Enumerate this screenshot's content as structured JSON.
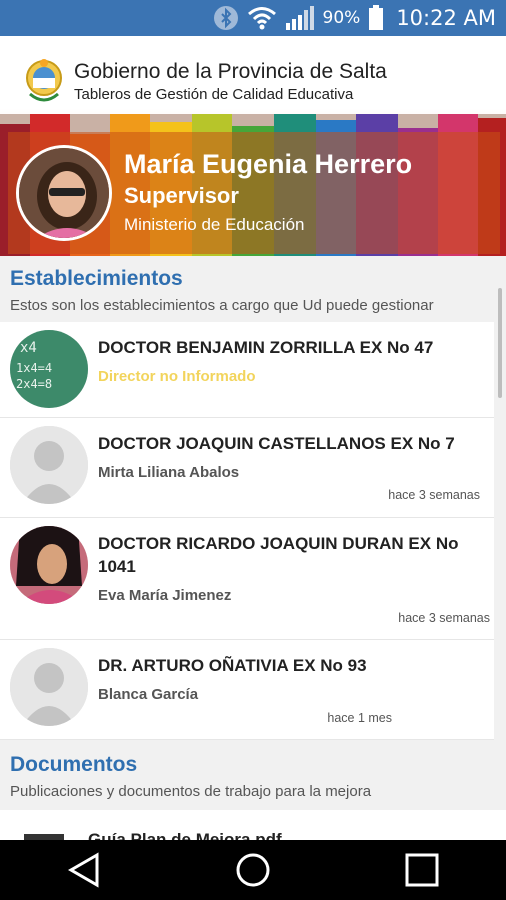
{
  "status_bar": {
    "battery": "90%",
    "time": "10:22 AM"
  },
  "header": {
    "gov_title": "Gobierno de la Provincia de Salta",
    "gov_subtitle": "Tableros de Gestión de Calidad Educativa",
    "user_name": "María Eugenia Herrero",
    "user_role": "Supervisor",
    "user_org": "Ministerio de Educación"
  },
  "establecimientos": {
    "title": "Establecimientos",
    "subtitle": "Estos son los establecimientos a cargo que Ud puede gestionar",
    "items": [
      {
        "name": "DOCTOR BENJAMIN ZORRILLA EX No 47",
        "director": "Director no Informado",
        "time": ""
      },
      {
        "name": "DOCTOR JOAQUIN CASTELLANOS EX No 7",
        "director": "Mirta Liliana Abalos",
        "time": "hace 3 semanas"
      },
      {
        "name": "DOCTOR RICARDO JOAQUIN DURAN EX No 1041",
        "director": "Eva María Jimenez",
        "time": "hace 3 semanas"
      },
      {
        "name": "DR. ARTURO OÑATIVIA EX No 93",
        "director": "Blanca García",
        "time": "hace 1 mes"
      }
    ]
  },
  "documentos": {
    "title": "Documentos",
    "subtitle": "Publicaciones y documentos de trabajo para la mejora",
    "items": [
      {
        "name": "Guía Plan de Mejora.pdf"
      }
    ]
  },
  "colors": {
    "accent": "#2f6fb0",
    "status_bar": "#3b74b3",
    "warning": "#f2d45c"
  }
}
